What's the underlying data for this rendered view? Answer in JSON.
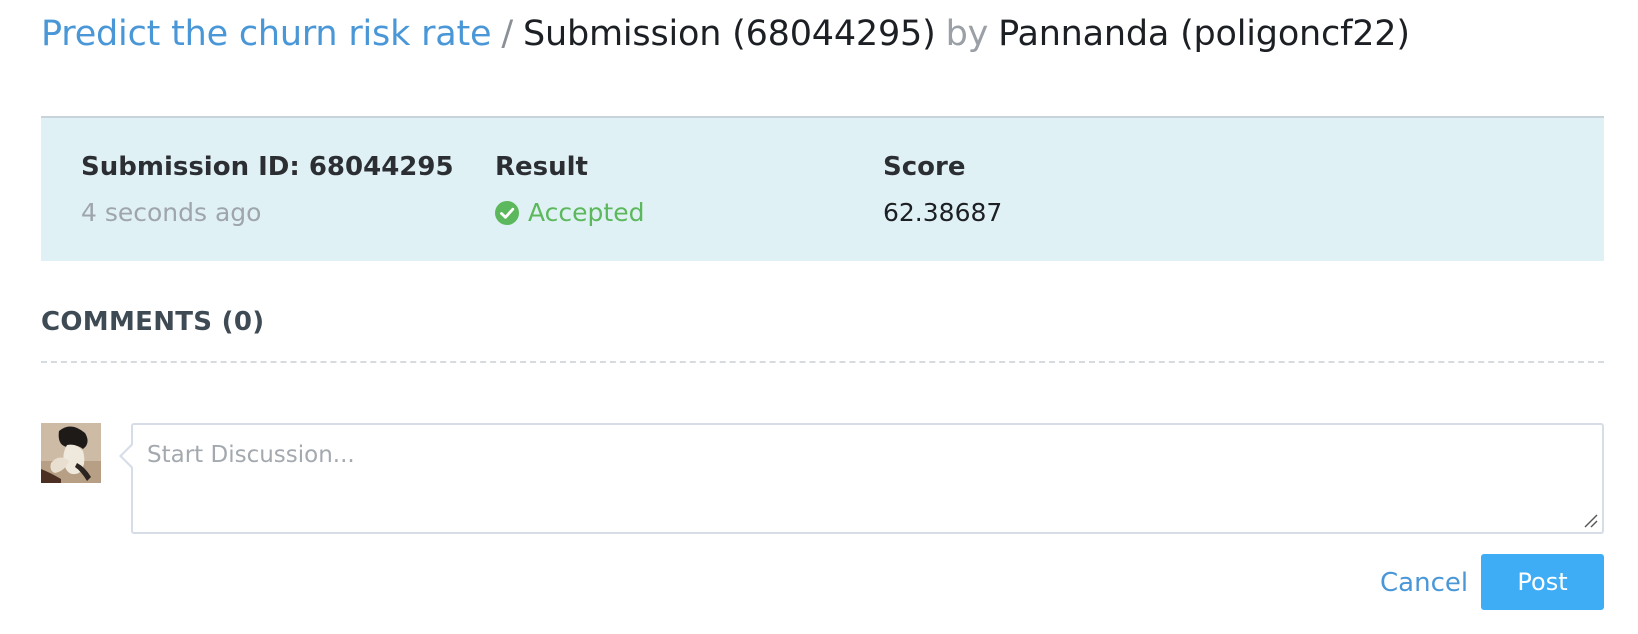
{
  "header": {
    "problem_link": "Predict the churn risk rate",
    "separator": "/",
    "submission_label": "Submission (68044295)",
    "by_label": "by",
    "user_label": "Pannanda (poligoncf22)"
  },
  "summary": {
    "submission_id_label": "Submission ID: 68044295",
    "time_ago": "4 seconds ago",
    "result_label": "Result",
    "result_value": "Accepted",
    "result_icon": "check-circle-icon",
    "score_label": "Score",
    "score_value": "62.38687"
  },
  "comments": {
    "header": "COMMENTS (0)",
    "placeholder": "Start Discussion...",
    "cancel_label": "Cancel",
    "post_label": "Post"
  },
  "colors": {
    "link": "#4a97d8",
    "panel_bg": "#e0f1f5",
    "accepted": "#5cb85c",
    "post_button": "#3fadf6"
  }
}
